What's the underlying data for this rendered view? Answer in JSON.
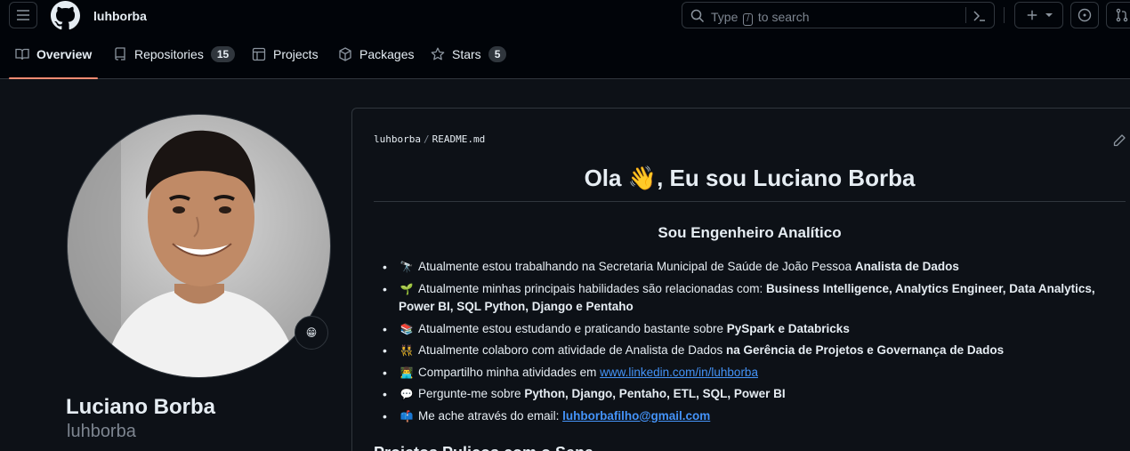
{
  "header": {
    "username_link": "luhborba",
    "search_prefix": "Type",
    "search_key": "/",
    "search_suffix": "to search"
  },
  "tabs": [
    {
      "label": "Overview",
      "icon": "book-icon"
    },
    {
      "label": "Repositories",
      "icon": "repo-icon",
      "count": "15"
    },
    {
      "label": "Projects",
      "icon": "table-icon"
    },
    {
      "label": "Packages",
      "icon": "package-icon"
    },
    {
      "label": "Stars",
      "icon": "star-icon",
      "count": "5"
    }
  ],
  "profile": {
    "full_name": "Luciano Borba",
    "login": "luhborba",
    "status_emoji": "😁"
  },
  "readme": {
    "path_user": "luhborba",
    "path_file": "README.md",
    "title": "Ola 👋, Eu sou Luciano Borba",
    "subtitle": "Sou Engenheiro Analítico",
    "items": [
      {
        "emoji": "🔭",
        "text": "Atualmente estou trabalhando na Secretaria Municipal de Saúde de João Pessoa ",
        "bold": "Analista de Dados"
      },
      {
        "emoji": "🌱",
        "text": "Atualmente minhas principais habilidades são relacionadas com: ",
        "bold": "Business Intelligence, Analytics Engineer, Data Analytics, Power BI, SQL Python, Django e Pentaho"
      },
      {
        "emoji": "📚",
        "text": "Atualmente estou estudando e praticando bastante sobre ",
        "bold": "PySpark e Databricks"
      },
      {
        "emoji": "👯",
        "text": "Atualmente colaboro com atividade de Analista de Dados ",
        "bold": "na Gerência de Projetos e Governança de Dados"
      },
      {
        "emoji": "👨‍💻",
        "text": "Compartilho minha atividades em ",
        "link": "www.linkedin.com/in/luhborba"
      },
      {
        "emoji": "💬",
        "text": "Pergunte-me sobre ",
        "bold": "Python, Django, Pentaho, ETL, SQL, Power BI"
      },
      {
        "emoji": "📫",
        "text": "Me ache através do email: ",
        "link_bold": "luhborbafilho@gmail.com"
      }
    ],
    "next_heading": "Projetos Pulicos com o Sena..."
  },
  "colors": {
    "accent_underline": "#fd8c73",
    "link": "#4493f8",
    "bg": "#0d1117",
    "header_bg": "#010409"
  }
}
